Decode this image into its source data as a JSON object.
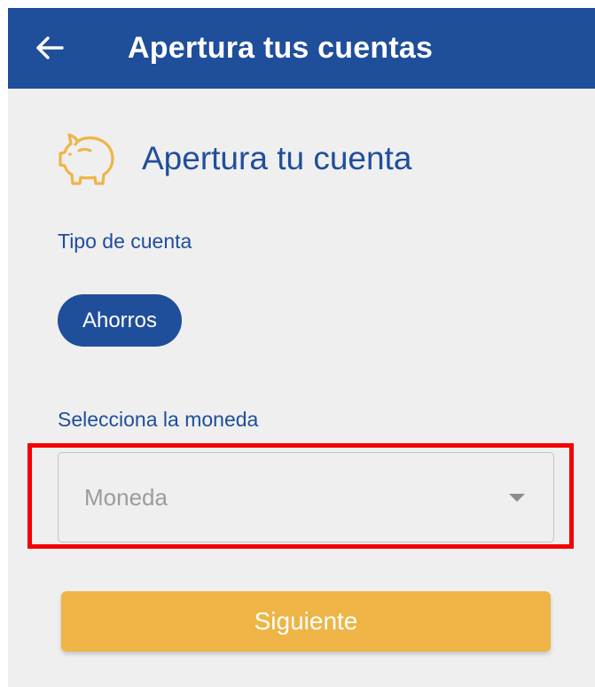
{
  "appbar": {
    "title": "Apertura tus cuentas",
    "back_icon": "arrow-left-icon",
    "color": "#1f4e9b"
  },
  "section": {
    "icon": "piggy-bank-icon",
    "icon_color": "#eeb546",
    "title": "Apertura tu cuenta"
  },
  "account_type": {
    "label": "Tipo de cuenta",
    "selected_option": "Ahorros"
  },
  "currency": {
    "label": "Selecciona la moneda",
    "placeholder": "Moneda",
    "dropdown_icon": "caret-down-icon"
  },
  "highlight": {
    "color": "#f40000"
  },
  "next_button": {
    "label": "Siguiente",
    "color": "#eeb546"
  }
}
